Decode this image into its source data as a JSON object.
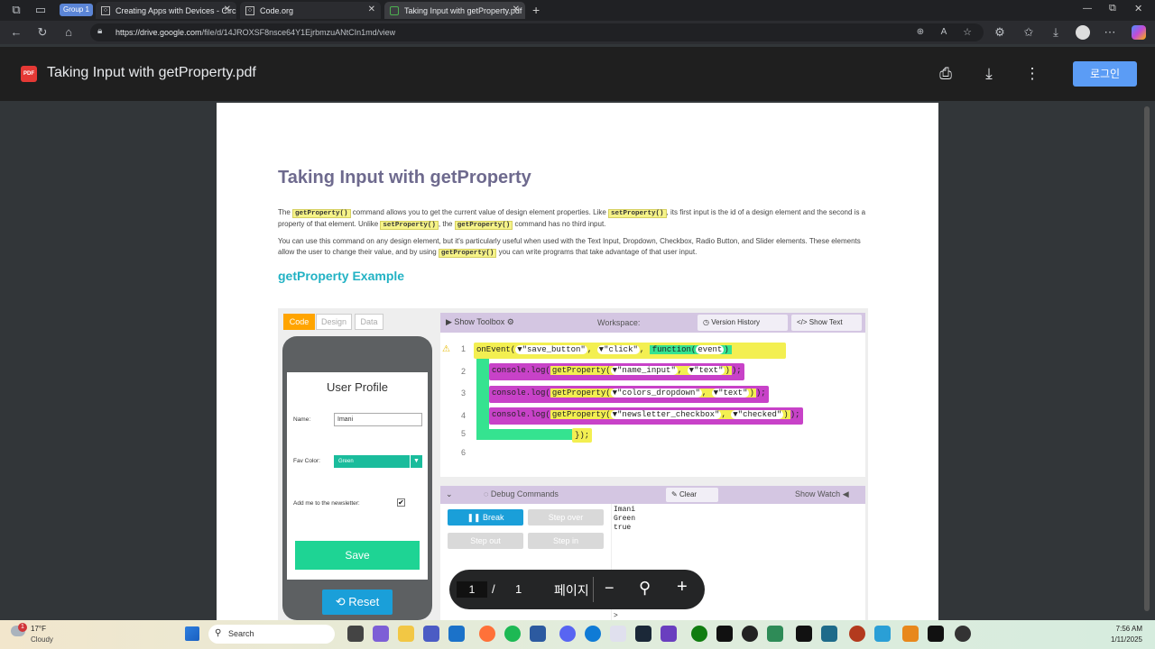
{
  "browser": {
    "tabs": [
      {
        "label": "Group 1"
      },
      {
        "label": "Creating Apps with Devices - Circ"
      },
      {
        "label": "Code.org"
      },
      {
        "label": "Taking Input with getProperty.pdf"
      }
    ],
    "url_host": "https://drive.google.com",
    "url_path": "/file/d/14JROXSF8nsce64Y1EjrbmzuANtCIn1md/view"
  },
  "drive": {
    "pdf_badge": "PDF",
    "title": "Taking Input with getProperty.pdf",
    "login_label": "로그인"
  },
  "document": {
    "heading": "Taking Input with getProperty",
    "p1": [
      "The ",
      "getProperty()",
      " command allows you to get the current value of design element properties. Like ",
      "setProperty()",
      ", its first input is the id of a design element and the second is a property of that element. Unlike ",
      "setProperty()",
      ", the ",
      "getProperty()",
      " command has no third input."
    ],
    "p2": [
      "You can use this command on any design element, but it's particularly useful when used with the Text Input, Dropdown, Checkbox, Radio Button, and Slider elements. These elements allow the user to change their value, and by using ",
      "getProperty()",
      " you can write programs that take advantage of that user input."
    ],
    "subheading": "getProperty Example"
  },
  "applab": {
    "tabs": [
      "Code",
      "Design",
      "Data"
    ],
    "app": {
      "title": "User Profile",
      "name_label": "Name:",
      "name_value": "Imani",
      "color_label": "Fav Color:",
      "color_value": "Green",
      "newsletter_label": "Add me to the newsletter:",
      "save_label": "Save",
      "reset_label": "Reset"
    },
    "workspace": {
      "show_toolbox": "Show Toolbox",
      "label": "Workspace:",
      "version_history": "Version History",
      "show_text": "Show Text",
      "line_numbers": [
        "1",
        "2",
        "3",
        "4",
        "5",
        "6"
      ],
      "line1": {
        "fn": "onEvent(",
        "a1": "\"save_button\"",
        "sep1": ",",
        "a2": "\"click\"",
        "sep2": ",",
        "kw": "function",
        "param": "event"
      },
      "line2": {
        "fn": "console.log(",
        "inner": "getProperty(",
        "a1": "\"name_input\"",
        "a2": "\"text\"",
        "end": ");"
      },
      "line3": {
        "fn": "console.log(",
        "inner": "getProperty(",
        "a1": "\"colors_dropdown\"",
        "a2": "\"text\"",
        "end": ");"
      },
      "line4": {
        "fn": "console.log(",
        "inner": "getProperty(",
        "a1": "\"newsletter_checkbox\"",
        "a2": "\"checked\"",
        "end": ");"
      },
      "line5": {
        "close": "});"
      }
    },
    "debug": {
      "title": "Debug Commands",
      "clear": "Clear",
      "show_watch": "Show Watch",
      "break": "Break",
      "step_over": "Step over",
      "step_out": "Step out",
      "step_in": "Step in",
      "output": [
        "Imani",
        "Green",
        "true"
      ],
      "prompt": ">"
    }
  },
  "pdf_toolbar": {
    "page": "1",
    "sep": "/",
    "total": "1",
    "page_label": "페이지"
  },
  "taskbar": {
    "temp": "17°F",
    "weather": "Cloudy",
    "search": "Search",
    "time": "7:56 AM",
    "date": "1/11/2025",
    "weather_badge": "1"
  }
}
